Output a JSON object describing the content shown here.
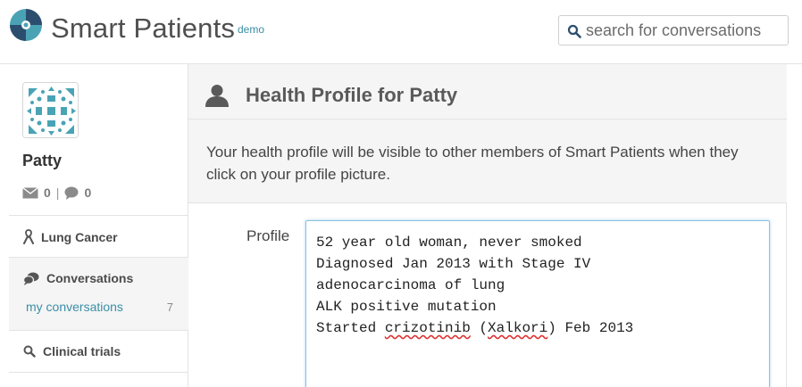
{
  "header": {
    "brand": "Smart Patients",
    "brand_tag": "demo",
    "search_placeholder": "search for conversations"
  },
  "sidebar": {
    "username": "Patty",
    "message_count": "0",
    "comment_count": "0",
    "condition": "Lung Cancer",
    "conversations_heading": "Conversations",
    "my_conversations_label": "my conversations",
    "my_conversations_count": "7",
    "clinical_trials": "Clinical trials"
  },
  "main": {
    "title": "Health Profile for Patty",
    "intro": "Your health profile will be visible to other members of Smart Patients when they click on your profile picture.",
    "profile_label": "Profile",
    "profile_lines": [
      "52 year old woman, never smoked",
      "Diagnosed Jan 2013 with Stage IV",
      "adenocarcinoma of lung",
      "ALK positive mutation",
      "Started ",
      "crizotinib",
      " (",
      "Xalkori",
      ") Feb 2013"
    ]
  },
  "colors": {
    "accent": "#3a8ea6",
    "logo_teal": "#4aa3b5",
    "logo_navy": "#2c4e6e"
  },
  "icons": [
    "logo-icon",
    "search-icon",
    "envelope-icon",
    "comment-icon",
    "ribbon-icon",
    "conversations-icon",
    "person-icon"
  ]
}
